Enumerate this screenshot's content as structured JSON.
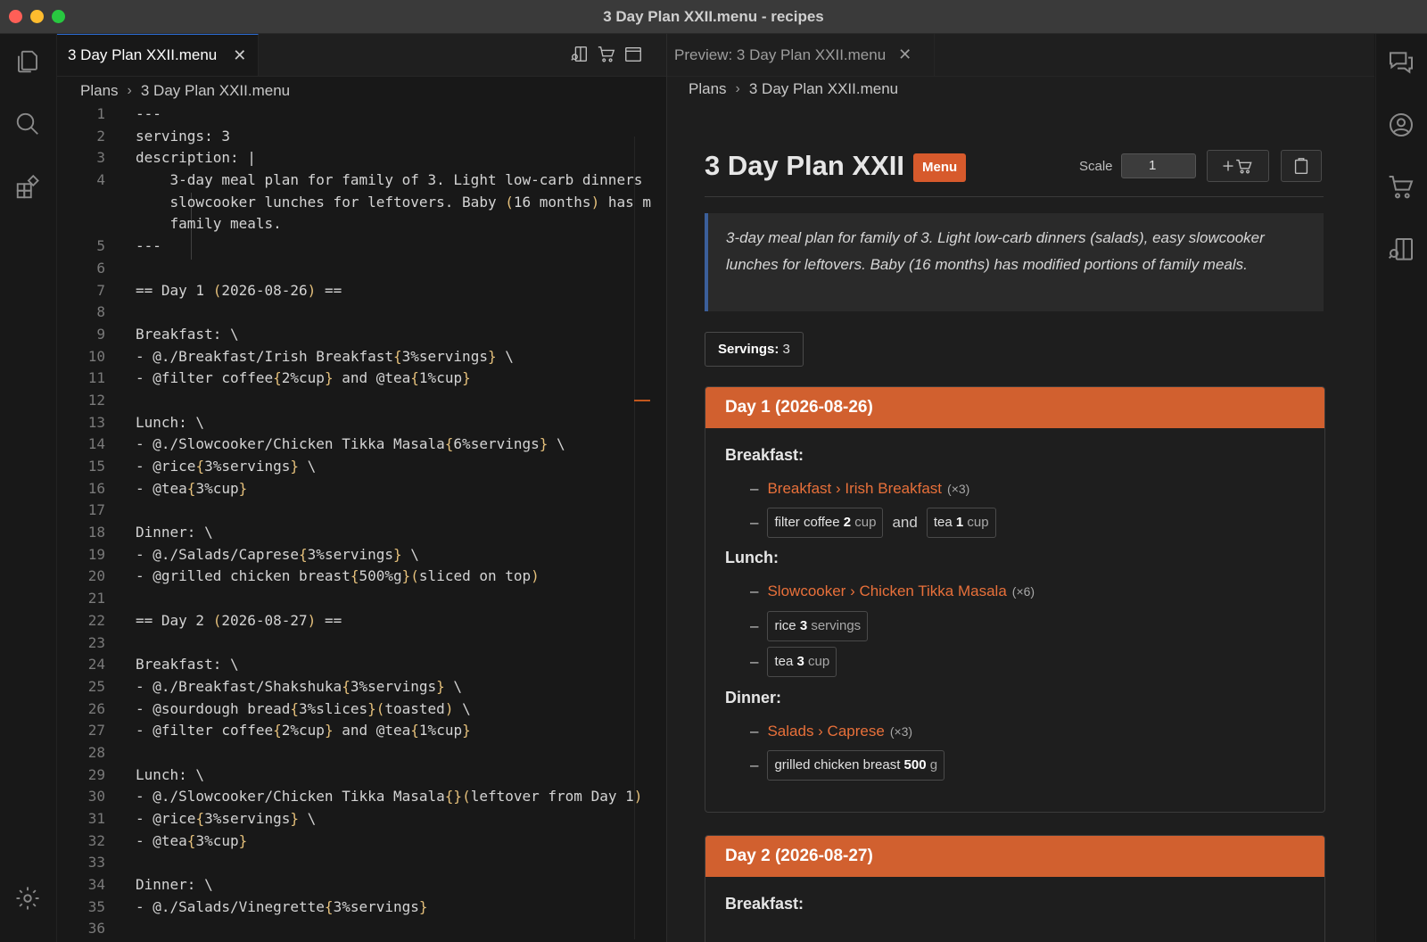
{
  "window": {
    "title": "3 Day Plan XXII.menu - recipes"
  },
  "editor": {
    "tab_label": "3 Day Plan XXII.menu",
    "breadcrumb": [
      "Plans",
      "3 Day Plan XXII.menu"
    ],
    "lines": [
      {
        "n": "1",
        "t": "---"
      },
      {
        "n": "2",
        "t": "servings: 3"
      },
      {
        "n": "3",
        "t": "description: |"
      },
      {
        "n": "4",
        "t": "    3-day meal plan for family of 3. Light low-carb dinners"
      },
      {
        "n": "",
        "t": "    slowcooker lunches for leftovers. Baby (16 months) has m"
      },
      {
        "n": "",
        "t": "    family meals."
      },
      {
        "n": "5",
        "t": "---"
      },
      {
        "n": "6",
        "t": ""
      },
      {
        "n": "7",
        "t": "== Day 1 (2026-08-26) =="
      },
      {
        "n": "8",
        "t": ""
      },
      {
        "n": "9",
        "t": "Breakfast: \\"
      },
      {
        "n": "10",
        "t": "- @./Breakfast/Irish Breakfast{3%servings} \\"
      },
      {
        "n": "11",
        "t": "- @filter coffee{2%cup} and @tea{1%cup}"
      },
      {
        "n": "12",
        "t": ""
      },
      {
        "n": "13",
        "t": "Lunch: \\"
      },
      {
        "n": "14",
        "t": "- @./Slowcooker/Chicken Tikka Masala{6%servings} \\"
      },
      {
        "n": "15",
        "t": "- @rice{3%servings} \\"
      },
      {
        "n": "16",
        "t": "- @tea{3%cup}"
      },
      {
        "n": "17",
        "t": ""
      },
      {
        "n": "18",
        "t": "Dinner: \\"
      },
      {
        "n": "19",
        "t": "- @./Salads/Caprese{3%servings} \\"
      },
      {
        "n": "20",
        "t": "- @grilled chicken breast{500%g}(sliced on top)"
      },
      {
        "n": "21",
        "t": ""
      },
      {
        "n": "22",
        "t": "== Day 2 (2026-08-27) =="
      },
      {
        "n": "23",
        "t": ""
      },
      {
        "n": "24",
        "t": "Breakfast: \\"
      },
      {
        "n": "25",
        "t": "- @./Breakfast/Shakshuka{3%servings} \\"
      },
      {
        "n": "26",
        "t": "- @sourdough bread{3%slices}(toasted) \\"
      },
      {
        "n": "27",
        "t": "- @filter coffee{2%cup} and @tea{1%cup}"
      },
      {
        "n": "28",
        "t": ""
      },
      {
        "n": "29",
        "t": "Lunch: \\"
      },
      {
        "n": "30",
        "t": "- @./Slowcooker/Chicken Tikka Masala{}(leftover from Day 1)"
      },
      {
        "n": "31",
        "t": "- @rice{3%servings} \\"
      },
      {
        "n": "32",
        "t": "- @tea{3%cup}"
      },
      {
        "n": "33",
        "t": ""
      },
      {
        "n": "34",
        "t": "Dinner: \\"
      },
      {
        "n": "35",
        "t": "- @./Salads/Vinegrette{3%servings}"
      },
      {
        "n": "36",
        "t": ""
      }
    ]
  },
  "preview": {
    "tab_label": "Preview: 3 Day Plan XXII.menu",
    "breadcrumb": [
      "Plans",
      "3 Day Plan XXII.menu"
    ],
    "title": "3 Day Plan XXII",
    "badge": "Menu",
    "scale_label": "Scale",
    "scale_value": "1",
    "description": "3-day meal plan for family of 3. Light low-carb dinners (salads), easy slowcooker lunches for leftovers. Baby (16 months) has modified portions of family meals.",
    "servings_label": "Servings:",
    "servings_value": "3",
    "day1": {
      "heading": "Day 1 (2026-08-26)",
      "breakfast": {
        "title": "Breakfast:",
        "recipe": "Breakfast › Irish Breakfast",
        "recipe_mult": "(×3)",
        "chip1_name": "filter coffee",
        "chip1_qty": "2",
        "chip1_unit": "cup",
        "and": "and",
        "chip2_name": "tea",
        "chip2_qty": "1",
        "chip2_unit": "cup"
      },
      "lunch": {
        "title": "Lunch:",
        "recipe": "Slowcooker › Chicken Tikka Masala",
        "recipe_mult": "(×6)",
        "chip1_name": "rice",
        "chip1_qty": "3",
        "chip1_unit": "servings",
        "chip2_name": "tea",
        "chip2_qty": "3",
        "chip2_unit": "cup"
      },
      "dinner": {
        "title": "Dinner:",
        "recipe": "Salads › Caprese",
        "recipe_mult": "(×3)",
        "chip1_name": "grilled chicken breast",
        "chip1_qty": "500",
        "chip1_unit": "g"
      }
    },
    "day2": {
      "heading": "Day 2 (2026-08-27)",
      "breakfast_title": "Breakfast:"
    }
  },
  "colors": {
    "accent": "#d1602f",
    "link": "#e8703a",
    "highlight": "#e5c07b"
  }
}
